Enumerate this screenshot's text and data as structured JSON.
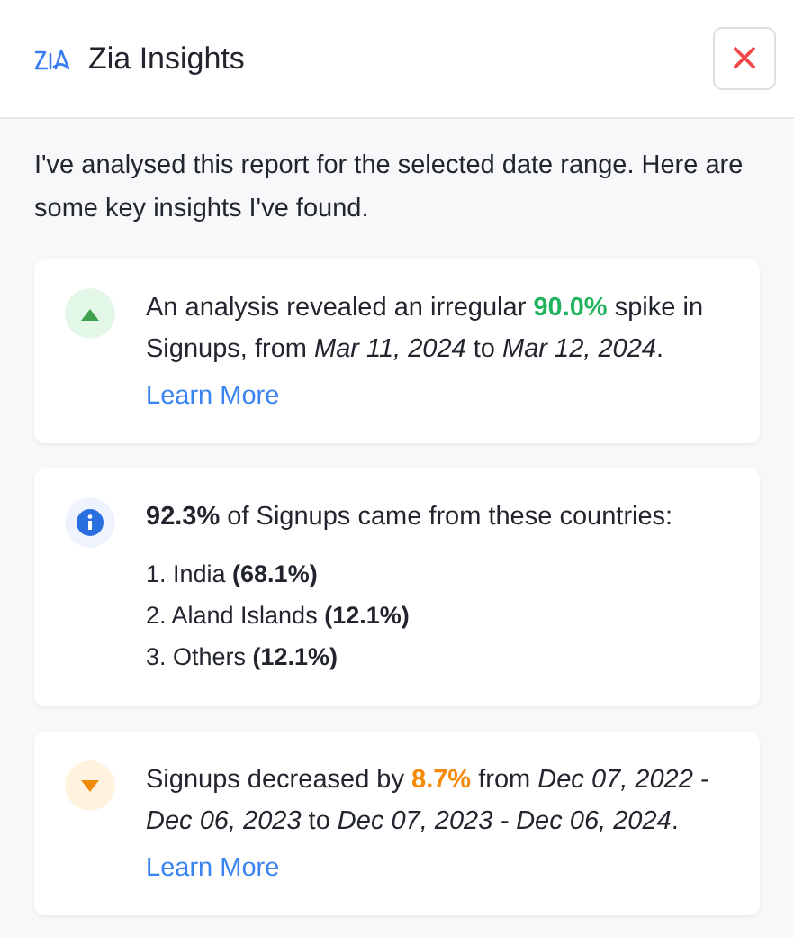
{
  "header": {
    "title": "Zia Insights",
    "close": "×"
  },
  "intro": "I've analysed this report for the selected date range. Here are some key insights I've found.",
  "insights": [
    {
      "kind": "increase",
      "parts": [
        {
          "text": "An analysis revealed an irregular ",
          "highlight": false
        },
        {
          "text": "90.0%",
          "highlight": true
        },
        {
          "text": " spike in Signups, from *Mar 11, 2024* to *Mar 12, 2024*.",
          "highlight": false
        }
      ],
      "link": "Learn More"
    },
    {
      "kind": "info",
      "parts": [
        {
          "text": "**92.3%** of Signups came from these countries:",
          "highlight": false
        }
      ],
      "list": [
        "1. India **(68.1%)**",
        "2. Aland Islands **(12.1%)**",
        "3. Others **(12.1%)**"
      ]
    },
    {
      "kind": "decrease",
      "parts": [
        {
          "text": "Signups decreased by ",
          "highlight": false
        },
        {
          "text": "8.7%",
          "highlight": true
        },
        {
          "text": " from *Dec 07, 2022 - Dec 06, 2023* to *Dec 07, 2023 - Dec 06, 2024*.",
          "highlight": false
        }
      ],
      "link": "Learn More"
    }
  ]
}
